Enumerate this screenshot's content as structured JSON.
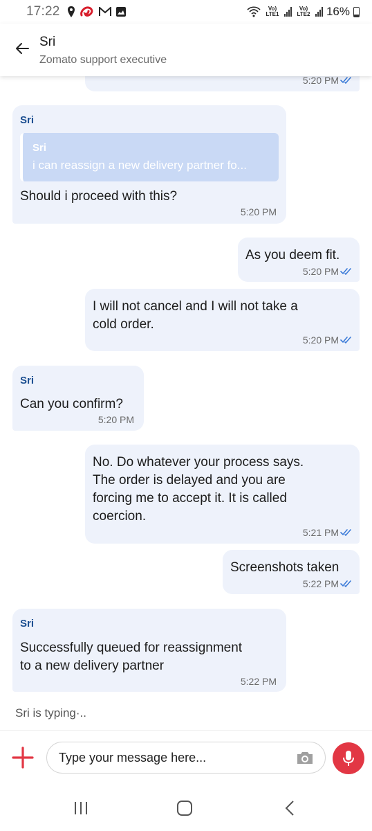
{
  "status_bar": {
    "time": "17:22",
    "sim1": "Vo) LTE1",
    "sim2": "Vo) LTE2",
    "battery": "16%",
    "left_icons": [
      "location-icon",
      "airtel-icon",
      "gmail-icon",
      "gallery-icon"
    ]
  },
  "header": {
    "name": "Sri",
    "subtitle": "Zomato support executive"
  },
  "messages": [
    {
      "side": "out",
      "time": "5:20 PM",
      "read": true
    },
    {
      "side": "in",
      "sender": "Sri",
      "quote_sender": "Sri",
      "quote_text": "i can reassign a new delivery partner fo...",
      "text": "Should i proceed with this?",
      "time": "5:20 PM"
    },
    {
      "side": "out",
      "text": "As you deem fit.",
      "time": "5:20 PM",
      "read": true
    },
    {
      "side": "out",
      "text_lines": [
        "I will not cancel and I will not take a",
        "cold order."
      ],
      "time": "5:20 PM",
      "read": true
    },
    {
      "side": "in",
      "sender": "Sri",
      "text": "Can you confirm?",
      "time": "5:20 PM"
    },
    {
      "side": "out",
      "text_lines": [
        "No. Do whatever your process says.",
        "The order is delayed and you are",
        "forcing me to accept it. It is called",
        "coercion."
      ],
      "time": "5:21 PM",
      "read": true
    },
    {
      "side": "out",
      "text": "Screenshots taken",
      "time": "5:22 PM",
      "read": true
    },
    {
      "side": "in",
      "sender": "Sri",
      "text_lines": [
        "Successfully queued for reassignment",
        "to a new delivery partner"
      ],
      "time": "5:22 PM"
    }
  ],
  "typing_indicator": "Sri is typing·..",
  "composer": {
    "placeholder": "Type your message here..."
  },
  "colors": {
    "bubble": "#eef2fb",
    "quote": "#c9d9f5",
    "accent_red": "#e23744",
    "sender_blue": "#1c4f91",
    "tick_blue": "#3b7bd8"
  }
}
